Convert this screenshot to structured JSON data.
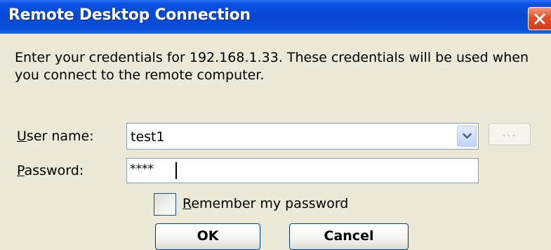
{
  "window": {
    "title": "Remote Desktop Connection"
  },
  "message": "Enter your credentials for 192.168.1.33. These credentials will be used when you connect to the remote computer.",
  "form": {
    "username_label_accel": "U",
    "username_label_rest": "ser name:",
    "username_value": "test1",
    "browse_label": "...",
    "password_label_accel": "P",
    "password_label_rest": "assword:",
    "password_value": "****",
    "remember_accel": "R",
    "remember_rest": "emember my password",
    "remember_checked": false
  },
  "buttons": {
    "ok": "OK",
    "cancel": "Cancel"
  },
  "colors": {
    "titlebar": "#0848d6",
    "window_bg": "#ECE9D8",
    "close_button": "#d23c18",
    "input_border": "#7f9db9"
  },
  "icons": {
    "close": "close-icon",
    "dropdown": "chevron-down-icon"
  }
}
